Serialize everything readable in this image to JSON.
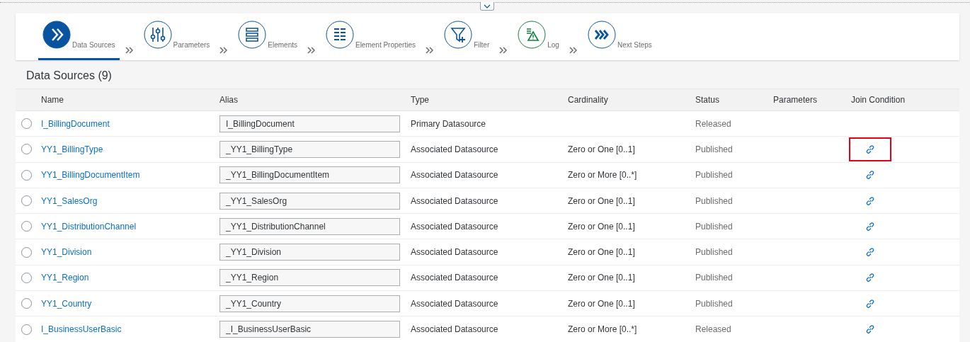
{
  "steps": [
    {
      "kind": "datasources",
      "label": "Data Sources",
      "selected": true
    },
    {
      "kind": "parameters",
      "label": "Parameters",
      "selected": false
    },
    {
      "kind": "elements",
      "label": "Elements",
      "selected": false
    },
    {
      "kind": "properties",
      "label": "Element Properties",
      "selected": false
    },
    {
      "kind": "filter",
      "label": "Filter",
      "selected": false
    },
    {
      "kind": "log",
      "label": "Log",
      "selected": false
    },
    {
      "kind": "next",
      "label": "Next Steps",
      "selected": false
    }
  ],
  "section_title": "Data Sources (9)",
  "table": {
    "columns": [
      "Name",
      "Alias",
      "Type",
      "Cardinality",
      "Status",
      "Parameters",
      "Join Condition"
    ],
    "rows": [
      {
        "selected": false,
        "name": "I_BillingDocument",
        "alias": "I_BillingDocument",
        "type": "Primary Datasource",
        "status": "Released",
        "join_link": false,
        "highlighted": false
      },
      {
        "selected": false,
        "name": "YY1_BillingType",
        "alias": "_YY1_BillingType",
        "type": "Associated Datasource",
        "cardinality": "Zero or One [0..1]",
        "status": "Published",
        "join_link": true,
        "highlighted": true
      },
      {
        "selected": false,
        "name": "YY1_BillingDocumentItem",
        "alias": "_YY1_BillingDocumentItem",
        "type": "Associated Datasource",
        "cardinality": "Zero or More [0..*]",
        "status": "Published",
        "join_link": true,
        "highlighted": false
      },
      {
        "selected": false,
        "name": "YY1_SalesOrg",
        "alias": "_YY1_SalesOrg",
        "type": "Associated Datasource",
        "cardinality": "Zero or One [0..1]",
        "status": "Published",
        "join_link": true,
        "highlighted": false
      },
      {
        "selected": false,
        "name": "YY1_DistributionChannel",
        "alias": "_YY1_DistributionChannel",
        "type": "Associated Datasource",
        "cardinality": "Zero or One [0..1]",
        "status": "Published",
        "join_link": true,
        "highlighted": false
      },
      {
        "selected": false,
        "name": "YY1_Division",
        "alias": "_YY1_Division",
        "type": "Associated Datasource",
        "cardinality": "Zero or One [0..1]",
        "status": "Published",
        "join_link": true,
        "highlighted": false
      },
      {
        "selected": false,
        "name": "YY1_Region",
        "alias": "_YY1_Region",
        "type": "Associated Datasource",
        "cardinality": "Zero or One [0..1]",
        "status": "Published",
        "join_link": true,
        "highlighted": false
      },
      {
        "selected": false,
        "name": "YY1_Country",
        "alias": "_YY1_Country",
        "type": "Associated Datasource",
        "cardinality": "Zero or One [0..1]",
        "status": "Published",
        "join_link": true,
        "highlighted": false
      },
      {
        "selected": false,
        "name": "I_BusinessUserBasic",
        "alias": "_I_BusinessUserBasic",
        "type": "Associated Datasource",
        "cardinality": "Zero or More [0..*]",
        "status": "Released",
        "join_link": true,
        "highlighted": false
      }
    ]
  }
}
